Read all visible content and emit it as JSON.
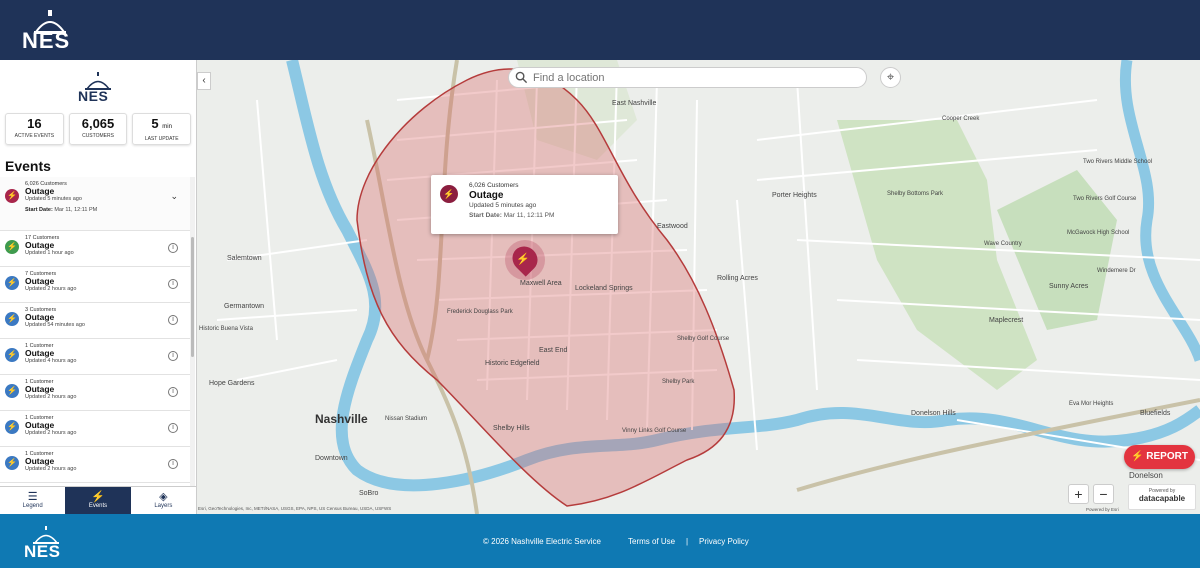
{
  "header": {
    "logo_text": "NES"
  },
  "sidebar": {
    "logo_text": "NES",
    "stats": [
      {
        "value": "16",
        "unit": "",
        "label": "Active events"
      },
      {
        "value": "6,065",
        "unit": "",
        "label": "Customers"
      },
      {
        "value": "5",
        "unit": "min",
        "label": "Last update"
      }
    ],
    "events_title": "Events",
    "events": [
      {
        "customers": "6,026 Customers",
        "type": "Outage",
        "updated": "Updated 5 minutes ago",
        "start_label": "Start Date:",
        "start_value": "Mar 11, 12:11 PM",
        "color": "#a8264b"
      },
      {
        "customers": "17 Customers",
        "type": "Outage",
        "updated": "Updated 1 hour ago",
        "color": "#3f9b4e"
      },
      {
        "customers": "7 Customers",
        "type": "Outage",
        "updated": "Updated 2 hours ago",
        "color": "#3b79c2"
      },
      {
        "customers": "3 Customers",
        "type": "Outage",
        "updated": "Updated 54 minutes ago",
        "color": "#3b79c2"
      },
      {
        "customers": "1 Customer",
        "type": "Outage",
        "updated": "Updated 4 hours ago",
        "color": "#3b79c2"
      },
      {
        "customers": "1 Customer",
        "type": "Outage",
        "updated": "Updated 2 hours ago",
        "color": "#3b79c2"
      },
      {
        "customers": "1 Customer",
        "type": "Outage",
        "updated": "Updated 2 hours ago",
        "color": "#3b79c2"
      },
      {
        "customers": "1 Customer",
        "type": "Outage",
        "updated": "Updated 2 hours ago",
        "color": "#3b79c2"
      }
    ],
    "tabs": [
      {
        "label": "Legend",
        "icon": "list-icon"
      },
      {
        "label": "Events",
        "icon": "lightning-icon"
      },
      {
        "label": "Layers",
        "icon": "layers-icon"
      }
    ]
  },
  "map": {
    "search_placeholder": "Find a location",
    "popup": {
      "customers": "6,026 Customers",
      "type": "Outage",
      "updated": "Updated 5 minutes ago",
      "start_label": "Start Date:",
      "start_value": "Mar 11, 12:11 PM"
    },
    "report_label": "REPORT",
    "powered_by": "Powered by",
    "brand": "datacapable",
    "attribution": "Esri, GeoTechnologies, Inc, METI/NASA, USGS, EPA, NPS, US Census Bureau, USDA, USFWS",
    "esri_credit": "Powered by Esri",
    "labels": [
      "Nashville",
      "East Nashville",
      "Lockeland Springs",
      "Maxwell Area",
      "Eastwood",
      "Rolling Acres",
      "Historic Edgefield",
      "East End",
      "Shelby Hills",
      "Shelby Park",
      "Shelby Bottoms Park",
      "Porter Heights",
      "Two Rivers Golf Course",
      "McGavock High School",
      "Two Rivers Middle School",
      "Sunny Acres",
      "Maplecrest",
      "Donelson Hills",
      "Eva Mor Heights",
      "Bluefields",
      "Donelson",
      "Salemtown",
      "Germantown",
      "Historic Buena Vista",
      "Hope Gardens",
      "Downtown",
      "SoBro",
      "Nissan Stadium",
      "Frederick Douglass Park",
      "Shelby Golf Course",
      "Vinny Links Golf Course",
      "Wave Country",
      "Windemere Dr",
      "Cooper Creek"
    ],
    "accent_outage": "#a8264b"
  },
  "footer": {
    "logo_text": "NES",
    "copyright": "© 2026 Nashville Electric Service",
    "terms": "Terms of Use",
    "separator": "|",
    "privacy": "Privacy Policy"
  }
}
